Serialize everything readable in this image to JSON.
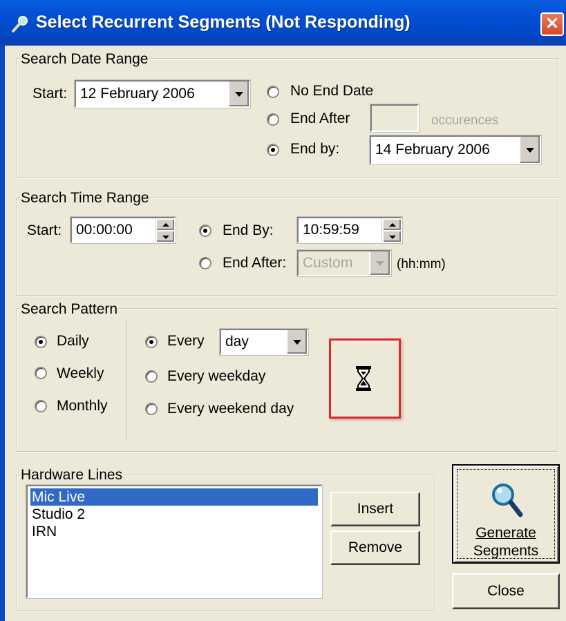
{
  "window": {
    "title": "Select Recurrent Segments (Not Responding)",
    "close_glyph": "✕"
  },
  "date_range": {
    "legend": "Search Date Range",
    "start_label": "Start:",
    "start_value": "12  February  2006",
    "no_end_date_label": "No End Date",
    "end_after_label": "End After",
    "end_after_value": "",
    "occurences_label": "occurences",
    "end_by_label": "End by:",
    "end_by_value": "14  February  2006",
    "selected": "end_by"
  },
  "time_range": {
    "legend": "Search Time Range",
    "start_label": "Start:",
    "start_value": "00:00:00",
    "end_by_label": "End By:",
    "end_by_value": "10:59:59",
    "end_after_label": "End After:",
    "end_after_value": "Custom",
    "hhmm_label": "(hh:mm)",
    "selected": "end_by"
  },
  "pattern": {
    "legend": "Search Pattern",
    "frequency": [
      "Daily",
      "Weekly",
      "Monthly"
    ],
    "frequency_selected": "Daily",
    "every_label": "Every",
    "every_value": "day",
    "every_weekday_label": "Every weekday",
    "every_weekend_label": "Every weekend day",
    "option_selected": "every"
  },
  "hardware": {
    "legend": "Hardware Lines",
    "items": [
      "Mic Live",
      "Studio 2",
      "IRN"
    ],
    "selected_index": 0,
    "insert_label": "Insert",
    "remove_label": "Remove"
  },
  "actions": {
    "generate_line1": "Generate",
    "generate_line2": "Segments",
    "close_label": "Close"
  },
  "icons": {
    "title": "magnifier-icon",
    "cursor": "hourglass-icon",
    "generate": "magnifier-icon"
  },
  "colors": {
    "titlebar": "#0350d6",
    "selection": "#316ac5",
    "highlight_box": "#e0282f",
    "face": "#ece9d8"
  }
}
